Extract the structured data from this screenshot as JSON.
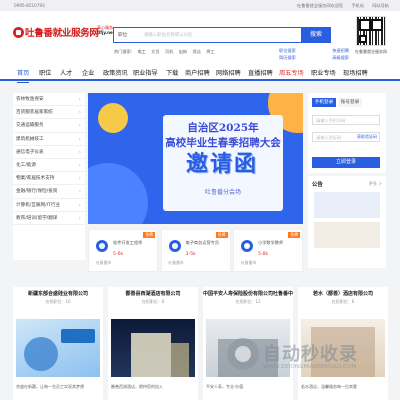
{
  "topbar": {
    "phone": "0995-8510793",
    "links": [
      "吐鲁番就业服务网欢迎您",
      "手机站",
      "网站导航"
    ]
  },
  "header": {
    "logo_text": "吐鲁番就业服务网",
    "logo_slogan": "真心服务",
    "logo_domain": "tlfjy.net",
    "search_type": "职位",
    "search_placeholder": "请输入职位名称或公司名",
    "search_button": "搜索",
    "hot_label": "热门搜索:",
    "hot_words": [
      "电工",
      "文员",
      "司机",
      "出纳",
      "保洁",
      "焊工"
    ],
    "links_row1": [
      "职位搜索",
      "快速招聘"
    ],
    "links_row2": [
      "简历搜索",
      "高级搜索"
    ],
    "qr_caption": "吐鲁番就业服务网"
  },
  "nav": {
    "items": [
      "首页",
      "职位",
      "人才",
      "企业",
      "政策资讯",
      "职业指导",
      "下载",
      "商户招聘",
      "网络招聘",
      "直播招聘",
      "周五专场",
      "职业专场",
      "现场招聘"
    ],
    "active_index": 0
  },
  "sidebar": {
    "categories": [
      "农林牧渔保安",
      "百货服装居家家纺",
      "交通运输服务",
      "建筑机械技工",
      "通信电子仪表",
      "化工/能源",
      "物業/家居技术支持",
      "金融/银行/保险/投资",
      "计算机/互联网/IT行业",
      "教育/培训/留学/翻译"
    ]
  },
  "banner": {
    "line1": "自治区2025年",
    "line2": "高校毕业生春季招聘大会",
    "headline": "邀请函",
    "footer": "吐鲁番分会场"
  },
  "jobs": [
    {
      "title": "软件开发工程师",
      "salary": "5-6k",
      "tag": "急聘",
      "sub": "吐鲁番市"
    },
    {
      "title": "电子商务运营专员",
      "salary": "3-5k",
      "tag": "急聘",
      "sub": "吐鲁番市"
    },
    {
      "title": "小学数学教师",
      "salary": "5-8k",
      "tag": "急聘",
      "sub": "吐鲁番市"
    }
  ],
  "login": {
    "tabs": [
      "手机登录",
      "账号登录"
    ],
    "phone_placeholder": "请输入手机号码",
    "code_placeholder": "请输入验证码",
    "code_link": "获取验证码",
    "button": "立即登录"
  },
  "ads": {
    "heading": "公告",
    "more": "更多 >"
  },
  "companies": [
    {
      "name": "新疆东部合盛硅业有限公司",
      "count": "在招职位：16",
      "desc": "合盛在新疆，让每一名员工实现其梦想",
      "img_colors": [
        "#cfe6f8",
        "#3e84d0"
      ]
    },
    {
      "name": "鄯善县西湖酒店有限公司",
      "count": "在招职位：8",
      "desc": "鄯善西湖酒店，期待您的加入",
      "img_colors": [
        "#12213f",
        "#e9e3c9"
      ]
    },
    {
      "name": "中国平安人寿保险股份有限公司吐鲁番中",
      "count": "在招职位：12",
      "desc": "平安人寿，专业·价值",
      "img_colors": [
        "#dde2e6",
        "#7b8791"
      ]
    },
    {
      "name": "若水（鄯善）酒店有限公司",
      "count": "在招职位：6",
      "desc": "若水酒店，温馨服务每一位宾客",
      "img_colors": [
        "#f5efe6",
        "#b09070"
      ]
    }
  ],
  "watermark": {
    "big": "自动秒收录",
    "small": "WWW.ZIDONGMIAOSHOULU.COM"
  },
  "colors": {
    "brand_blue": "#2a5ee0",
    "brand_red": "#d21d1d",
    "accent_orange": "#ff7a1a"
  }
}
